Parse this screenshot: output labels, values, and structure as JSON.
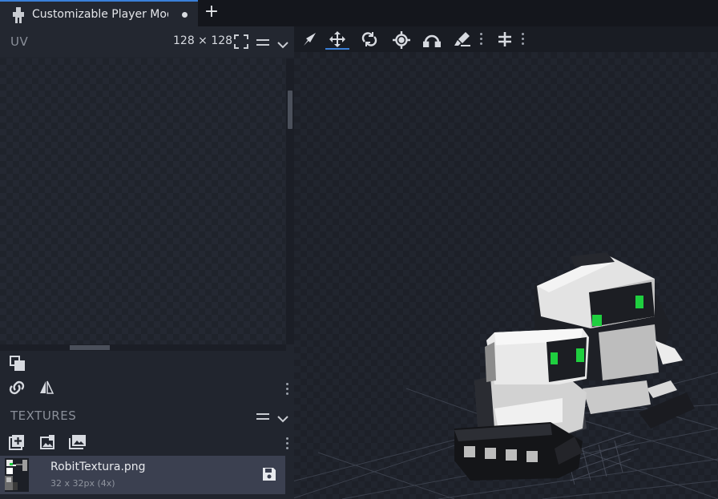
{
  "tab": {
    "title": "Customizable Player Models"
  },
  "uv_panel": {
    "label": "UV",
    "size_label": "128 ⨯ 128"
  },
  "textures_panel": {
    "label": "TEXTURES"
  },
  "texture_item": {
    "name": "RobitTextura.png",
    "info": "32 x 32px (4x)"
  },
  "viewport": {
    "tools": [
      "vertex-snap-icon",
      "move-icon",
      "rotate-icon",
      "pivot-icon",
      "resize-icon",
      "paint-brush-icon",
      "mirror-icon"
    ],
    "active_tool": "move-icon"
  },
  "colors": {
    "accent": "#3a7fd8",
    "eye_green": "#1fcf3f"
  }
}
